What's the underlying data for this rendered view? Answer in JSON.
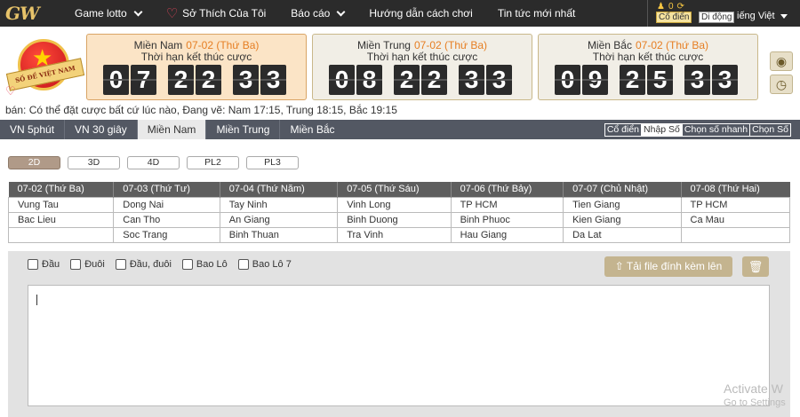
{
  "nav": {
    "logo": "GW",
    "items": [
      {
        "label": "Game lotto",
        "has_dropdown": true
      },
      {
        "label": "Sở Thích Của Tôi",
        "icon": "heart-icon"
      },
      {
        "label": "Báo cáo",
        "has_dropdown": true
      },
      {
        "label": "Hướng dẫn cách chơi"
      },
      {
        "label": "Tin tức mới nhất"
      }
    ],
    "user_count": "0",
    "mode_classic": "Cổ điển",
    "mode_mobile": "Di động",
    "language": "iếng Việt"
  },
  "badge": {
    "text": "SỐ ĐỀ VIỆT NAM"
  },
  "regions": [
    {
      "name": "Miền Nam",
      "date": "07-02 (Thứ Ba)",
      "subtitle": "Thời hạn kết thúc cược",
      "digits": [
        "0",
        "7",
        "2",
        "2",
        "3",
        "3"
      ]
    },
    {
      "name": "Miền Trung",
      "date": "07-02 (Thứ Ba)",
      "subtitle": "Thời hạn kết thúc cược",
      "digits": [
        "0",
        "8",
        "2",
        "2",
        "3",
        "3"
      ]
    },
    {
      "name": "Miền Bắc",
      "date": "07-02 (Thứ Ba)",
      "subtitle": "Thời hạn kết thúc cược",
      "digits": [
        "0",
        "9",
        "2",
        "5",
        "3",
        "3"
      ]
    }
  ],
  "info_line": "bán: Có thể đặt cược bất cứ lúc nào,    Đang vẽ: Nam 17:15, Trung 18:15, Bắc 19:15",
  "region_tabs": [
    "VN 5phút",
    "VN 30 giây",
    "Miền Nam",
    "Miền Trung",
    "Miền Bắc"
  ],
  "active_region_tab": 2,
  "mode_tabs": [
    "Cổ điển",
    "Nhập Số",
    "Chọn số nhanh",
    "Chọn Số"
  ],
  "active_mode_tab": 1,
  "game_types": [
    "2D",
    "3D",
    "4D",
    "PL2",
    "PL3"
  ],
  "active_game_type": 0,
  "schedule": {
    "headers": [
      "07-02 (Thứ Ba)",
      "07-03 (Thứ Tư)",
      "07-04 (Thứ Năm)",
      "07-05 (Thứ Sáu)",
      "07-06 (Thứ Bảy)",
      "07-07 (Chủ Nhật)",
      "07-08 (Thứ Hai)"
    ],
    "rows": [
      [
        "Vung Tau",
        "Dong Nai",
        "Tay Ninh",
        "Vinh Long",
        "TP HCM",
        "Tien Giang",
        "TP HCM"
      ],
      [
        "Bac Lieu",
        "Can Tho",
        "An Giang",
        "Binh Duong",
        "Binh Phuoc",
        "Kien Giang",
        "Ca Mau"
      ],
      [
        "",
        "Soc Trang",
        "Binh Thuan",
        "Tra Vinh",
        "Hau Giang",
        "Da Lat",
        ""
      ]
    ]
  },
  "bet_options": [
    "Đầu",
    "Đuôi",
    "Đầu, đuôi",
    "Bao Lô",
    "Bao Lô 7"
  ],
  "upload_label": "Tải file đính kèm lên",
  "bet_input_value": "",
  "watermark": {
    "line1": "Activate W",
    "line2": "Go to Settings"
  }
}
